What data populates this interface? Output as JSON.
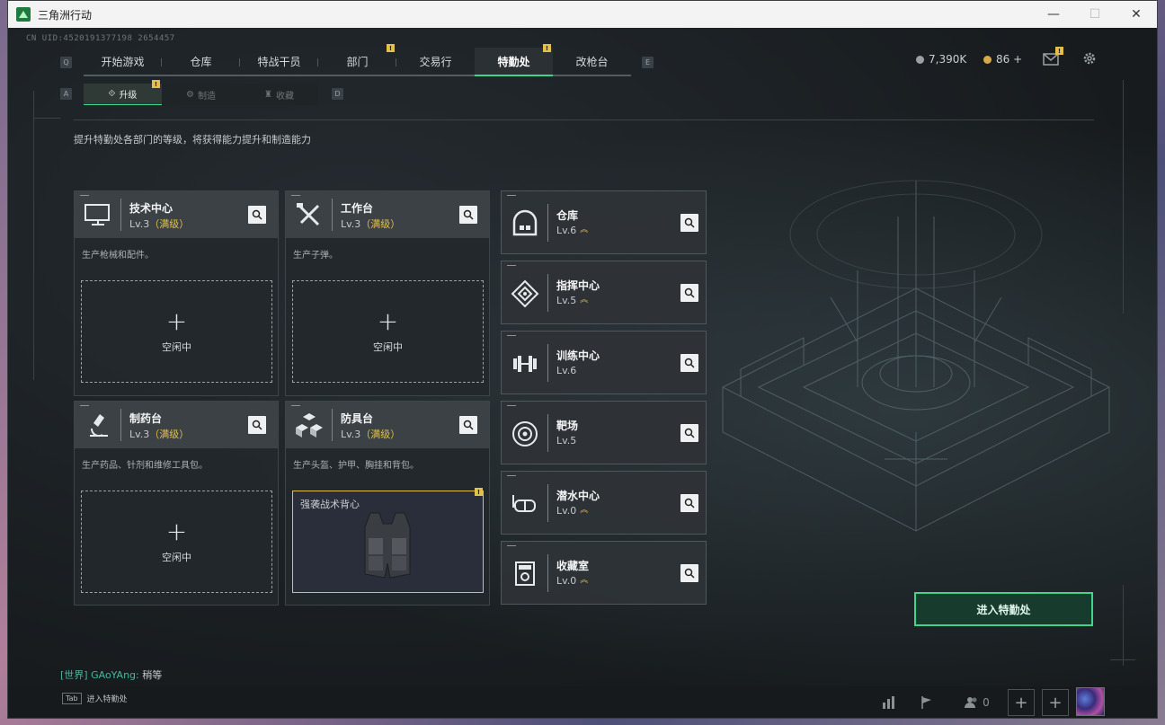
{
  "window": {
    "title": "三角洲行动",
    "minimize": "—",
    "maximize": "☐",
    "close": "✕"
  },
  "uid": "CN UID:4520191377198 2654457",
  "nav": {
    "left_key": "Q",
    "right_key": "E",
    "tabs": [
      {
        "label": "开始游戏",
        "active": false,
        "badge": ""
      },
      {
        "label": "仓库",
        "active": false,
        "badge": ""
      },
      {
        "label": "特战干员",
        "active": false,
        "badge": ""
      },
      {
        "label": "部门",
        "active": false,
        "badge": "!"
      },
      {
        "label": "交易行",
        "active": false,
        "badge": ""
      },
      {
        "label": "特勤处",
        "active": true,
        "badge": "!"
      },
      {
        "label": "改枪台",
        "active": false,
        "badge": ""
      }
    ]
  },
  "currency": {
    "coins": "7,390K",
    "gold": "86 +"
  },
  "subnav": {
    "left_key": "A",
    "right_key": "D",
    "tabs": [
      {
        "label": "升级",
        "active": true,
        "badge": "!"
      },
      {
        "label": "制造",
        "active": false
      },
      {
        "label": "收藏",
        "active": false
      }
    ]
  },
  "description": "提升特勤处各部门的等级，将获得能力提升和制造能力",
  "cards": [
    {
      "title": "技术中心",
      "level": "Lv.3",
      "max": "（满级）",
      "desc": "生产枪械和配件。",
      "slot": "空闲中"
    },
    {
      "title": "工作台",
      "level": "Lv.3",
      "max": "（满级）",
      "desc": "生产子弹。",
      "slot": "空闲中"
    },
    {
      "title": "制药台",
      "level": "Lv.3",
      "max": "（满级）",
      "desc": "生产药品、针剂和维修工具包。",
      "slot": "空闲中"
    },
    {
      "title": "防具台",
      "level": "Lv.3",
      "max": "（满级）",
      "desc": "生产头盔、护甲、胸挂和背包。",
      "slot_item": "强袭战术背心",
      "slot_badge": "!"
    }
  ],
  "facilities": [
    {
      "title": "仓库",
      "level": "Lv.6",
      "upgradable": true
    },
    {
      "title": "指挥中心",
      "level": "Lv.5",
      "upgradable": true
    },
    {
      "title": "训练中心",
      "level": "Lv.6",
      "upgradable": false
    },
    {
      "title": "靶场",
      "level": "Lv.5",
      "upgradable": false
    },
    {
      "title": "潜水中心",
      "level": "Lv.0",
      "upgradable": true
    },
    {
      "title": "收藏室",
      "level": "Lv.0",
      "upgradable": true
    }
  ],
  "enter_button": "进入特勤处",
  "chat": {
    "channel": "[世界]",
    "name": "GAoYAng:",
    "message": "稍等"
  },
  "bottom": {
    "tab_key": "Tab",
    "tab_label": "进入特勤处",
    "friends_count": "0"
  },
  "colors": {
    "accent": "#3fd68a",
    "badge": "#e3c04a",
    "max_level": "#e3c04a"
  }
}
